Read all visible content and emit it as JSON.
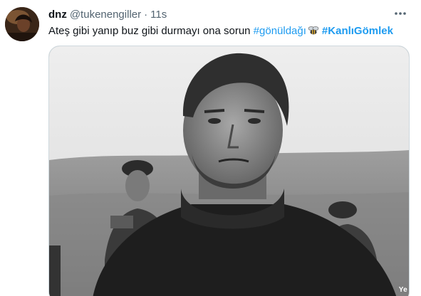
{
  "tweet": {
    "display_name": "dnz",
    "handle": "@tukenengiller",
    "separator": "·",
    "time": "11s",
    "text_before": "Ateş gibi yanıp buz gibi durmayı ona  sorun",
    "hashtag1": "#gönüldağı",
    "hashtag2": "#KanlıGömlek",
    "emoji_icon": "bee-icon",
    "more_icon": "more-horizontal-icon"
  },
  "media": {
    "watermark": "Ye",
    "description_colors": {
      "sky": "#e6e6e6",
      "hills": "#8c8c8c",
      "sweater": "#1e1e1e"
    }
  },
  "colors": {
    "link": "#1d9bf0",
    "secondary_text": "#536471",
    "border": "#cfd9de"
  }
}
